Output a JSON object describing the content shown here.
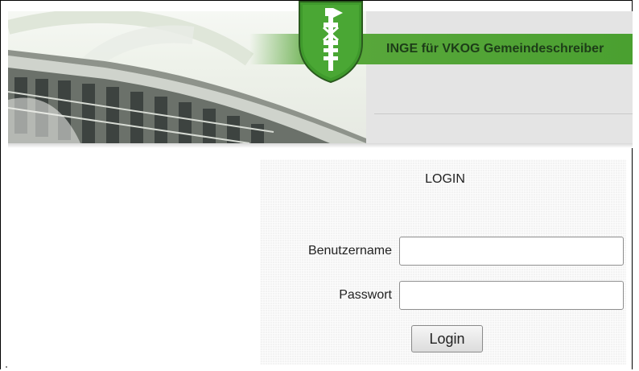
{
  "header": {
    "title": "INGE für VKOG Gemeindeschreiber",
    "crest_icon": "canton-st-gallen-crest-icon",
    "brand_green": "#4aa030"
  },
  "login": {
    "heading": "LOGIN",
    "username_label": "Benutzername",
    "username_value": "",
    "password_label": "Passwort",
    "password_value": "",
    "button_label": "Login"
  }
}
